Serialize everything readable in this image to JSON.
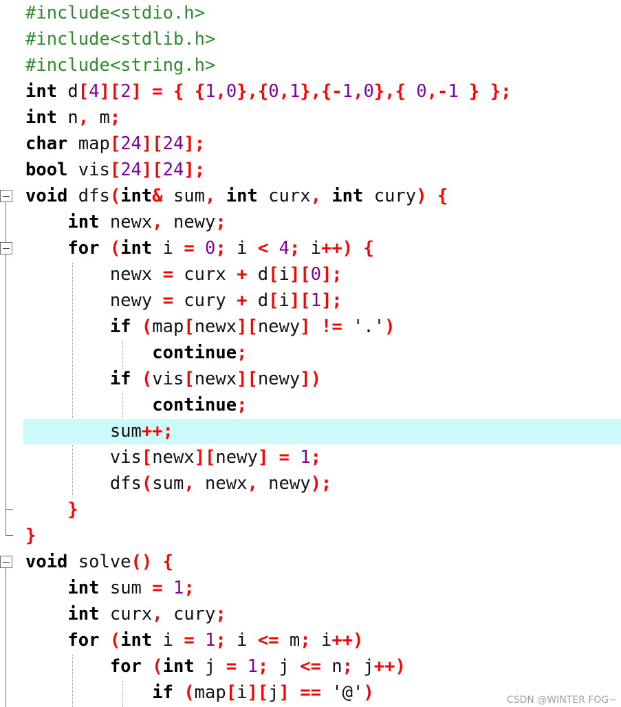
{
  "editor": {
    "highlighted_line": 17,
    "lines": [
      [
        [
          "pp",
          "#include<stdio.h>"
        ]
      ],
      [
        [
          "pp",
          "#include<stdlib.h>"
        ]
      ],
      [
        [
          "pp",
          "#include<string.h>"
        ]
      ],
      [
        [
          "kw",
          "int"
        ],
        [
          "id",
          " d"
        ],
        [
          "op",
          "["
        ],
        [
          "num",
          "4"
        ],
        [
          "op",
          "]["
        ],
        [
          "num",
          "2"
        ],
        [
          "op",
          "]"
        ],
        [
          "id",
          " "
        ],
        [
          "op",
          "="
        ],
        [
          "id",
          " "
        ],
        [
          "op",
          "{"
        ],
        [
          "id",
          " "
        ],
        [
          "op",
          "{"
        ],
        [
          "num",
          "1"
        ],
        [
          "op",
          ","
        ],
        [
          "num",
          "0"
        ],
        [
          "op",
          "},{"
        ],
        [
          "num",
          "0"
        ],
        [
          "op",
          ","
        ],
        [
          "num",
          "1"
        ],
        [
          "op",
          "},{-"
        ],
        [
          "num",
          "1"
        ],
        [
          "op",
          ","
        ],
        [
          "num",
          "0"
        ],
        [
          "op",
          "},{"
        ],
        [
          "id",
          " "
        ],
        [
          "num",
          "0"
        ],
        [
          "op",
          ",-"
        ],
        [
          "num",
          "1"
        ],
        [
          "id",
          " "
        ],
        [
          "op",
          "}"
        ],
        [
          "id",
          " "
        ],
        [
          "op",
          "};"
        ]
      ],
      [
        [
          "kw",
          "int"
        ],
        [
          "id",
          " n"
        ],
        [
          "op",
          ","
        ],
        [
          "id",
          " m"
        ],
        [
          "op",
          ";"
        ]
      ],
      [
        [
          "kw",
          "char"
        ],
        [
          "id",
          " map"
        ],
        [
          "op",
          "["
        ],
        [
          "num",
          "24"
        ],
        [
          "op",
          "]["
        ],
        [
          "num",
          "24"
        ],
        [
          "op",
          "];"
        ]
      ],
      [
        [
          "kw",
          "bool"
        ],
        [
          "id",
          " vis"
        ],
        [
          "op",
          "["
        ],
        [
          "num",
          "24"
        ],
        [
          "op",
          "]["
        ],
        [
          "num",
          "24"
        ],
        [
          "op",
          "];"
        ]
      ],
      [
        [
          "kw",
          "void"
        ],
        [
          "id",
          " dfs"
        ],
        [
          "op",
          "("
        ],
        [
          "kw",
          "int"
        ],
        [
          "op",
          "&"
        ],
        [
          "id",
          " sum"
        ],
        [
          "op",
          ","
        ],
        [
          "id",
          " "
        ],
        [
          "kw",
          "int"
        ],
        [
          "id",
          " curx"
        ],
        [
          "op",
          ","
        ],
        [
          "id",
          " "
        ],
        [
          "kw",
          "int"
        ],
        [
          "id",
          " cury"
        ],
        [
          "op",
          ")"
        ],
        [
          "id",
          " "
        ],
        [
          "op",
          "{"
        ]
      ],
      [
        [
          "id",
          "    "
        ],
        [
          "kw",
          "int"
        ],
        [
          "id",
          " newx"
        ],
        [
          "op",
          ","
        ],
        [
          "id",
          " newy"
        ],
        [
          "op",
          ";"
        ]
      ],
      [
        [
          "id",
          "    "
        ],
        [
          "kw",
          "for"
        ],
        [
          "id",
          " "
        ],
        [
          "op",
          "("
        ],
        [
          "kw",
          "int"
        ],
        [
          "id",
          " i "
        ],
        [
          "op",
          "="
        ],
        [
          "id",
          " "
        ],
        [
          "num",
          "0"
        ],
        [
          "op",
          ";"
        ],
        [
          "id",
          " i "
        ],
        [
          "op",
          "<"
        ],
        [
          "id",
          " "
        ],
        [
          "num",
          "4"
        ],
        [
          "op",
          ";"
        ],
        [
          "id",
          " i"
        ],
        [
          "op",
          "++)"
        ],
        [
          "id",
          " "
        ],
        [
          "op",
          "{"
        ]
      ],
      [
        [
          "id",
          "        newx "
        ],
        [
          "op",
          "="
        ],
        [
          "id",
          " curx "
        ],
        [
          "op",
          "+"
        ],
        [
          "id",
          " d"
        ],
        [
          "op",
          "["
        ],
        [
          "id",
          "i"
        ],
        [
          "op",
          "]["
        ],
        [
          "num",
          "0"
        ],
        [
          "op",
          "];"
        ]
      ],
      [
        [
          "id",
          "        newy "
        ],
        [
          "op",
          "="
        ],
        [
          "id",
          " cury "
        ],
        [
          "op",
          "+"
        ],
        [
          "id",
          " d"
        ],
        [
          "op",
          "["
        ],
        [
          "id",
          "i"
        ],
        [
          "op",
          "]["
        ],
        [
          "num",
          "1"
        ],
        [
          "op",
          "];"
        ]
      ],
      [
        [
          "id",
          "        "
        ],
        [
          "kw",
          "if"
        ],
        [
          "id",
          " "
        ],
        [
          "op",
          "("
        ],
        [
          "id",
          "map"
        ],
        [
          "op",
          "["
        ],
        [
          "id",
          "newx"
        ],
        [
          "op",
          "]["
        ],
        [
          "id",
          "newy"
        ],
        [
          "op",
          "]"
        ],
        [
          "id",
          " "
        ],
        [
          "op",
          "!="
        ],
        [
          "id",
          " "
        ],
        [
          "str",
          "'.'"
        ],
        [
          "op",
          ")"
        ]
      ],
      [
        [
          "id",
          "            "
        ],
        [
          "kw",
          "continue"
        ],
        [
          "op",
          ";"
        ]
      ],
      [
        [
          "id",
          "        "
        ],
        [
          "kw",
          "if"
        ],
        [
          "id",
          " "
        ],
        [
          "op",
          "("
        ],
        [
          "id",
          "vis"
        ],
        [
          "op",
          "["
        ],
        [
          "id",
          "newx"
        ],
        [
          "op",
          "]["
        ],
        [
          "id",
          "newy"
        ],
        [
          "op",
          "])"
        ]
      ],
      [
        [
          "id",
          "            "
        ],
        [
          "kw",
          "continue"
        ],
        [
          "op",
          ";"
        ]
      ],
      [
        [
          "id",
          "        sum"
        ],
        [
          "op",
          "++;"
        ]
      ],
      [
        [
          "id",
          "        vis"
        ],
        [
          "op",
          "["
        ],
        [
          "id",
          "newx"
        ],
        [
          "op",
          "]["
        ],
        [
          "id",
          "newy"
        ],
        [
          "op",
          "]"
        ],
        [
          "id",
          " "
        ],
        [
          "op",
          "="
        ],
        [
          "id",
          " "
        ],
        [
          "num",
          "1"
        ],
        [
          "op",
          ";"
        ]
      ],
      [
        [
          "id",
          "        dfs"
        ],
        [
          "op",
          "("
        ],
        [
          "id",
          "sum"
        ],
        [
          "op",
          ","
        ],
        [
          "id",
          " newx"
        ],
        [
          "op",
          ","
        ],
        [
          "id",
          " newy"
        ],
        [
          "op",
          ");"
        ]
      ],
      [
        [
          "id",
          "    "
        ],
        [
          "op",
          "}"
        ]
      ],
      [
        [
          "op",
          "}"
        ]
      ],
      [
        [
          "kw",
          "void"
        ],
        [
          "id",
          " solve"
        ],
        [
          "op",
          "()"
        ],
        [
          "id",
          " "
        ],
        [
          "op",
          "{"
        ]
      ],
      [
        [
          "id",
          "    "
        ],
        [
          "kw",
          "int"
        ],
        [
          "id",
          " sum "
        ],
        [
          "op",
          "="
        ],
        [
          "id",
          " "
        ],
        [
          "num",
          "1"
        ],
        [
          "op",
          ";"
        ]
      ],
      [
        [
          "id",
          "    "
        ],
        [
          "kw",
          "int"
        ],
        [
          "id",
          " curx"
        ],
        [
          "op",
          ","
        ],
        [
          "id",
          " cury"
        ],
        [
          "op",
          ";"
        ]
      ],
      [
        [
          "id",
          "    "
        ],
        [
          "kw",
          "for"
        ],
        [
          "id",
          " "
        ],
        [
          "op",
          "("
        ],
        [
          "kw",
          "int"
        ],
        [
          "id",
          " i "
        ],
        [
          "op",
          "="
        ],
        [
          "id",
          " "
        ],
        [
          "num",
          "1"
        ],
        [
          "op",
          ";"
        ],
        [
          "id",
          " i "
        ],
        [
          "op",
          "<="
        ],
        [
          "id",
          " m"
        ],
        [
          "op",
          ";"
        ],
        [
          "id",
          " i"
        ],
        [
          "op",
          "++)"
        ]
      ],
      [
        [
          "id",
          "        "
        ],
        [
          "kw",
          "for"
        ],
        [
          "id",
          " "
        ],
        [
          "op",
          "("
        ],
        [
          "kw",
          "int"
        ],
        [
          "id",
          " j "
        ],
        [
          "op",
          "="
        ],
        [
          "id",
          " "
        ],
        [
          "num",
          "1"
        ],
        [
          "op",
          ";"
        ],
        [
          "id",
          " j "
        ],
        [
          "op",
          "<="
        ],
        [
          "id",
          " n"
        ],
        [
          "op",
          ";"
        ],
        [
          "id",
          " j"
        ],
        [
          "op",
          "++)"
        ]
      ],
      [
        [
          "id",
          "            "
        ],
        [
          "kw",
          "if"
        ],
        [
          "id",
          " "
        ],
        [
          "op",
          "("
        ],
        [
          "id",
          "map"
        ],
        [
          "op",
          "["
        ],
        [
          "id",
          "i"
        ],
        [
          "op",
          "]["
        ],
        [
          "id",
          "j"
        ],
        [
          "op",
          "]"
        ],
        [
          "id",
          " "
        ],
        [
          "op",
          "=="
        ],
        [
          "id",
          " "
        ],
        [
          "str",
          "'@'"
        ],
        [
          "op",
          ")"
        ]
      ]
    ]
  },
  "watermark": "CSDN @WINTER FOG~",
  "colors": {
    "preprocessor": "#2e8b2e",
    "keyword": "#000000",
    "operator": "#ff0000",
    "number": "#8000a0",
    "identifier": "#111111",
    "current_line": "#ccf9f9"
  },
  "icons": {
    "fold": "minus-box-icon"
  }
}
